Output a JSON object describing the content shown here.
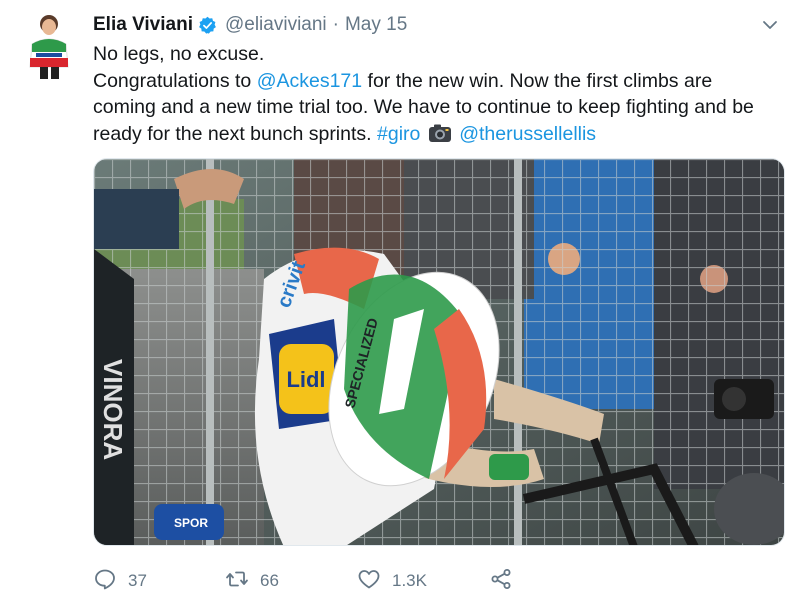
{
  "author": {
    "display_name": "Elia Viviani",
    "handle": "@eliaviviani",
    "separator": "·",
    "date": "May 15",
    "verified": true
  },
  "tweet": {
    "line1": "No legs, no excuse.",
    "line2_pre": "Congratulations to ",
    "mention1": "@Ackes171",
    "line2_post": " for the new win. Now the first climbs are",
    "line3": "coming and a new time trial too. We have to continue to keep fighting and be",
    "line4_pre": "ready for the next bunch sprints. ",
    "hashtag": "#giro",
    "mention2": "@therussellellis"
  },
  "media": {
    "kit_text_1": "crivit",
    "kit_text_2": "Lidl",
    "helmet_text": "SPECIALIZED",
    "banner_text": "VINORA",
    "mic_text": "SPOR"
  },
  "actions": {
    "reply_count": "37",
    "retweet_count": "66",
    "like_count": "1.3K"
  },
  "colors": {
    "link": "#1b95e0",
    "verified": "#1da1f2",
    "muted": "#657786"
  },
  "icons": [
    "verified-icon",
    "caret-down-icon",
    "camera-icon",
    "reply-icon",
    "retweet-icon",
    "like-icon",
    "share-icon"
  ]
}
